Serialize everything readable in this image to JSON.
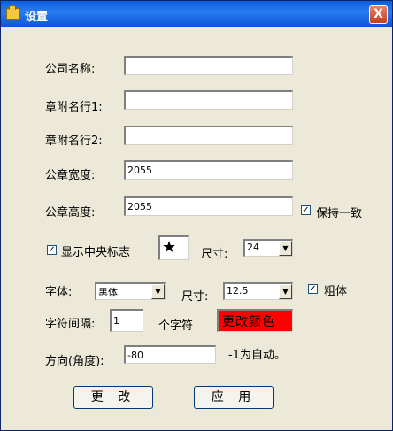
{
  "window": {
    "title": "设置",
    "close_label": "X"
  },
  "form": {
    "company_name": {
      "label": "公司名称:",
      "value": ""
    },
    "attach_line1": {
      "label": "章附名行1:",
      "value": ""
    },
    "attach_line2": {
      "label": "章附名行2:",
      "value": ""
    },
    "seal_width": {
      "label": "公章宽度:",
      "value": "2055"
    },
    "seal_height": {
      "label": "公章高度:",
      "value": "2055"
    },
    "keep_ratio": {
      "label": "保持一致",
      "checked": true,
      "mark": "✓"
    },
    "show_center_mark": {
      "label": "显示中央标志",
      "checked": true,
      "mark": "✓"
    },
    "mark_preview": "★",
    "mark_size": {
      "label": "尺寸:",
      "value": "24"
    },
    "font": {
      "label": "字体:",
      "value": "黑体"
    },
    "font_size": {
      "label": "尺寸:",
      "value": "12.5"
    },
    "bold": {
      "label": "粗体",
      "checked": true,
      "mark": "✓"
    },
    "char_spacing": {
      "label": "字符间隔:",
      "value": "1",
      "unit": "个字符"
    },
    "change_color_label": "更改颜色",
    "change_color_bg": "#ff0000",
    "direction": {
      "label": "方向(角度):",
      "value": "-80",
      "hint": "-1为自动。"
    }
  },
  "buttons": {
    "change": "更 改",
    "apply": "应 用"
  },
  "dropdown_arrow": "▼"
}
